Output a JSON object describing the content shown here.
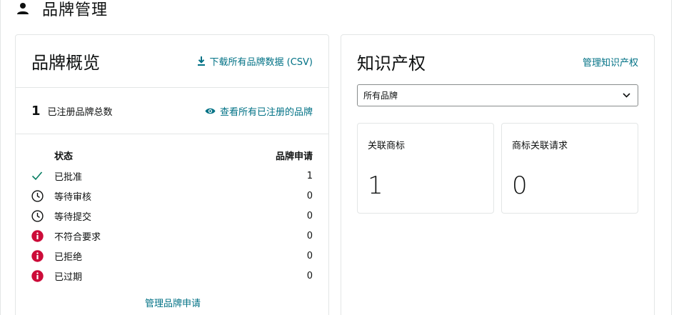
{
  "header": {
    "title": "品牌管理",
    "icon": "person-icon"
  },
  "overview": {
    "title": "品牌概览",
    "download_link": "下载所有品牌数据 (CSV)",
    "registered_count": "1",
    "registered_label": "已注册品牌总数",
    "view_all_link": "查看所有已注册的品牌",
    "table": {
      "col_status": "状态",
      "col_applications": "品牌申请",
      "rows": [
        {
          "label": "已批准",
          "value": "1",
          "icon": "check-icon",
          "color": "#067d62"
        },
        {
          "label": "等待审核",
          "value": "0",
          "icon": "clock-icon",
          "color": "#0f1111"
        },
        {
          "label": "等待提交",
          "value": "0",
          "icon": "clock-icon",
          "color": "#0f1111"
        },
        {
          "label": "不符合要求",
          "value": "0",
          "icon": "alert-icon",
          "color": "#cc0c39"
        },
        {
          "label": "已拒绝",
          "value": "0",
          "icon": "alert-icon",
          "color": "#cc0c39"
        },
        {
          "label": "已过期",
          "value": "0",
          "icon": "alert-icon",
          "color": "#cc0c39"
        }
      ]
    },
    "manage_link": "管理品牌申请"
  },
  "ip": {
    "title": "知识产权",
    "manage_link": "管理知识产权",
    "select_value": "所有品牌",
    "metrics": [
      {
        "label": "关联商标",
        "value": "1"
      },
      {
        "label": "商标关联请求",
        "value": "0"
      }
    ]
  },
  "colors": {
    "link": "#007185",
    "border": "#e3e6e6",
    "success": "#067d62",
    "error": "#cc0c39"
  }
}
